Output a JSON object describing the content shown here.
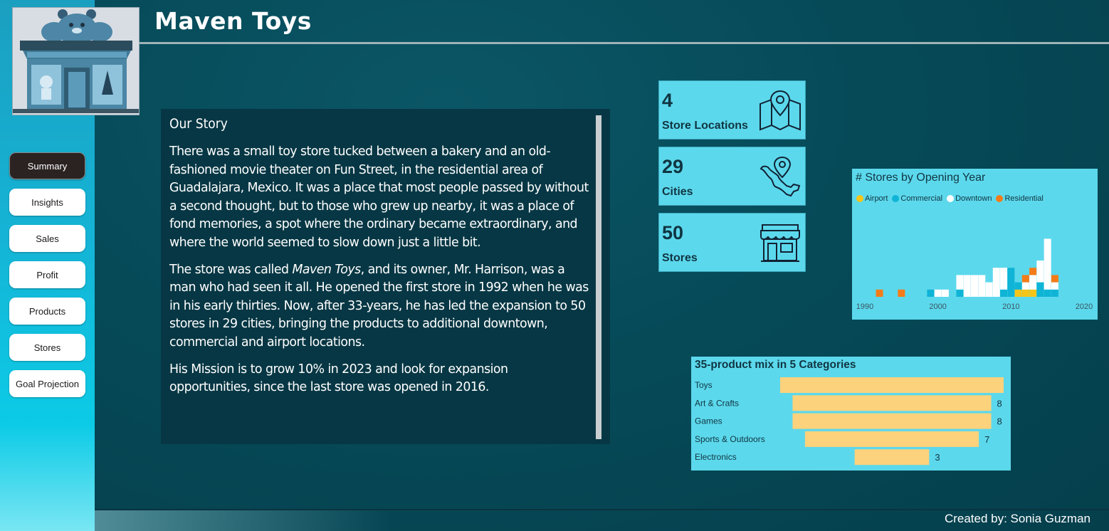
{
  "header": {
    "title": "Maven Toys"
  },
  "sidebar": {
    "logo": "toy-store-logo",
    "items": [
      {
        "label": "Summary",
        "active": true
      },
      {
        "label": "Insights"
      },
      {
        "label": "Sales"
      },
      {
        "label": "Profit"
      },
      {
        "label": "Products"
      },
      {
        "label": "Stores"
      },
      {
        "label": "Goal Projection"
      }
    ]
  },
  "story": {
    "title": "Our Story",
    "p1": "There was a small toy store tucked between a bakery and an old-fashioned movie theater on Fun Street, in the residential area of Guadalajara, Mexico. It was a place that most people passed by without a second thought, but to those who grew up nearby, it was a place of fond memories, a spot where the ordinary became extraordinary, and where the world seemed to slow down just a little bit.",
    "p2_prefix": "The store was called ",
    "p2_name": "Maven Toys",
    "p2_rest": ", and its owner, Mr. Harrison, was a man who had seen it all. He opened the first store in 1992 when he was in his early thirties. Now, after 33-years, he has led the expansion to 50 stores in 29 cities, bringing the products to additional downtown, commercial and airport locations.",
    "p3": "His Mission is to grow 10% in 2023 and look for expansion opportunities, since the last store was opened in 2016."
  },
  "kpis": [
    {
      "value": "4",
      "label": "Store Locations",
      "icon": "map-pin-icon"
    },
    {
      "value": "29",
      "label": "Cities",
      "icon": "mexico-map-pin-icon"
    },
    {
      "value": "50",
      "label": "Stores",
      "icon": "storefront-icon"
    }
  ],
  "colors": {
    "Airport": "#f5c518",
    "Commercial": "#0fb4d6",
    "Downtown": "#ffffff",
    "Residential": "#f47c18",
    "bar": "#fcd27c"
  },
  "chart_data": [
    {
      "type": "bar",
      "stacked": true,
      "title": "# Stores by Opening Year",
      "legend": [
        "Airport",
        "Commercial",
        "Downtown",
        "Residential"
      ],
      "legend_position": "top-left",
      "x_ticks": [
        "1990",
        "2000",
        "2010",
        "2020"
      ],
      "years": [
        1992,
        1995,
        1999,
        2000,
        2001,
        2003,
        2004,
        2005,
        2006,
        2007,
        2008,
        2009,
        2010,
        2011,
        2012,
        2013,
        2014,
        2015,
        2016
      ],
      "series": [
        {
          "name": "Airport",
          "values": [
            0,
            0,
            0,
            0,
            0,
            0,
            0,
            0,
            0,
            0,
            0,
            0,
            0,
            1,
            1,
            1,
            0,
            0,
            0
          ]
        },
        {
          "name": "Commercial",
          "values": [
            0,
            0,
            1,
            0,
            0,
            1,
            0,
            0,
            0,
            0,
            0,
            1,
            4,
            1,
            0,
            0,
            2,
            1,
            1
          ]
        },
        {
          "name": "Downtown",
          "values": [
            0,
            0,
            0,
            1,
            1,
            2,
            3,
            3,
            3,
            2,
            4,
            3,
            0,
            0,
            1,
            2,
            3,
            7,
            1
          ]
        },
        {
          "name": "Residential",
          "values": [
            1,
            1,
            0,
            0,
            0,
            0,
            0,
            0,
            0,
            0,
            0,
            0,
            0,
            0,
            1,
            1,
            0,
            0,
            1
          ]
        }
      ]
    },
    {
      "type": "bar",
      "orientation": "horizontal",
      "title": "35-product mix in 5 Categories",
      "categories": [
        "Toys",
        "Art & Crafts",
        "Games",
        "Sports & Outdoors",
        "Electronics"
      ],
      "values": [
        9,
        8,
        8,
        7,
        3
      ],
      "data_labels": [
        "",
        "8",
        "8",
        "7",
        "3"
      ]
    }
  ],
  "footer": {
    "credit": "Created by: Sonia Guzman"
  }
}
